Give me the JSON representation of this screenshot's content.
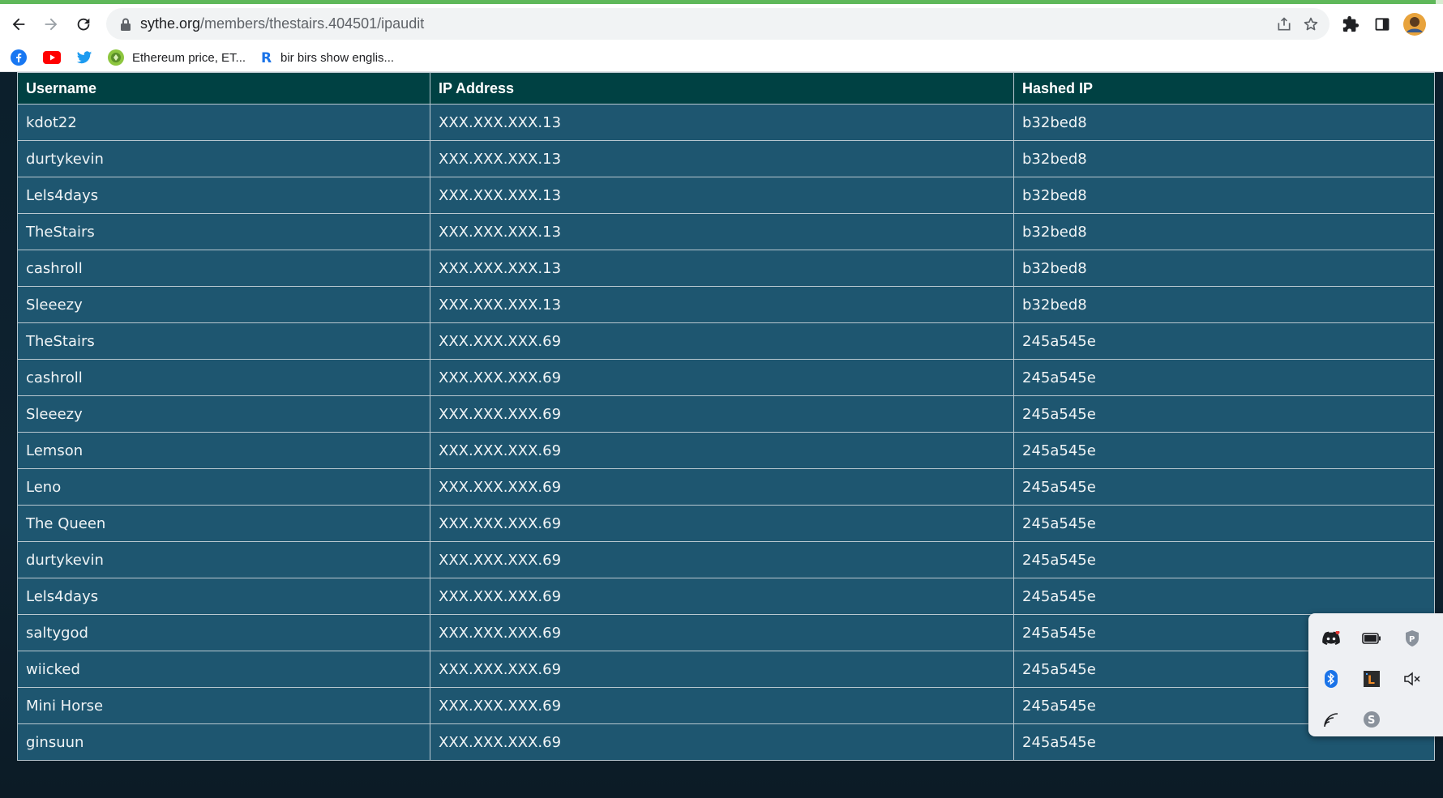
{
  "browser": {
    "url_host": "sythe.org",
    "url_path": "/members/thestairs.404501/ipaudit",
    "progress": 0.995
  },
  "bookmarks": [
    {
      "icon": "facebook-icon",
      "label": ""
    },
    {
      "icon": "youtube-icon",
      "label": ""
    },
    {
      "icon": "twitter-icon",
      "label": ""
    },
    {
      "icon": "ethereum-site-icon",
      "label": "Ethereum price, ET..."
    },
    {
      "icon": "r-site-icon",
      "label": "bir birs show englis..."
    }
  ],
  "table": {
    "headers": [
      "Username",
      "IP Address",
      "Hashed IP"
    ],
    "rows": [
      {
        "username": "kdot22",
        "ip": "XXX.XXX.XXX.13",
        "hash": "b32bed8"
      },
      {
        "username": "durtykevin",
        "ip": "XXX.XXX.XXX.13",
        "hash": "b32bed8"
      },
      {
        "username": "Lels4days",
        "ip": "XXX.XXX.XXX.13",
        "hash": "b32bed8"
      },
      {
        "username": "TheStairs",
        "ip": "XXX.XXX.XXX.13",
        "hash": "b32bed8"
      },
      {
        "username": "cashroll",
        "ip": "XXX.XXX.XXX.13",
        "hash": "b32bed8"
      },
      {
        "username": "Sleeezy",
        "ip": "XXX.XXX.XXX.13",
        "hash": "b32bed8"
      },
      {
        "username": "TheStairs",
        "ip": "XXX.XXX.XXX.69",
        "hash": "245a545e"
      },
      {
        "username": "cashroll",
        "ip": "XXX.XXX.XXX.69",
        "hash": "245a545e"
      },
      {
        "username": "Sleeezy",
        "ip": "XXX.XXX.XXX.69",
        "hash": "245a545e"
      },
      {
        "username": "Lemson",
        "ip": "XXX.XXX.XXX.69",
        "hash": "245a545e"
      },
      {
        "username": "Leno",
        "ip": "XXX.XXX.XXX.69",
        "hash": "245a545e"
      },
      {
        "username": "The Queen",
        "ip": "XXX.XXX.XXX.69",
        "hash": "245a545e"
      },
      {
        "username": "durtykevin",
        "ip": "XXX.XXX.XXX.69",
        "hash": "245a545e"
      },
      {
        "username": "Lels4days",
        "ip": "XXX.XXX.XXX.69",
        "hash": "245a545e"
      },
      {
        "username": "saltygod",
        "ip": "XXX.XXX.XXX.69",
        "hash": "245a545e"
      },
      {
        "username": "wiicked",
        "ip": "XXX.XXX.XXX.69",
        "hash": "245a545e"
      },
      {
        "username": "Mini Horse",
        "ip": "XXX.XXX.XXX.69",
        "hash": "245a545e"
      },
      {
        "username": "ginsuun",
        "ip": "XXX.XXX.XXX.69",
        "hash": "245a545e"
      }
    ]
  },
  "tray_icons": [
    "discord-icon",
    "battery-icon",
    "vpn-shield-icon",
    "bluetooth-icon",
    "app-l-icon",
    "volume-muted-icon",
    "wifi-icon",
    "skype-icon"
  ],
  "colors": {
    "header_bg": "#004143",
    "row_bg": "#1e5670",
    "page_bg": "#0e2230",
    "loading_bar": "#5fb85a"
  }
}
